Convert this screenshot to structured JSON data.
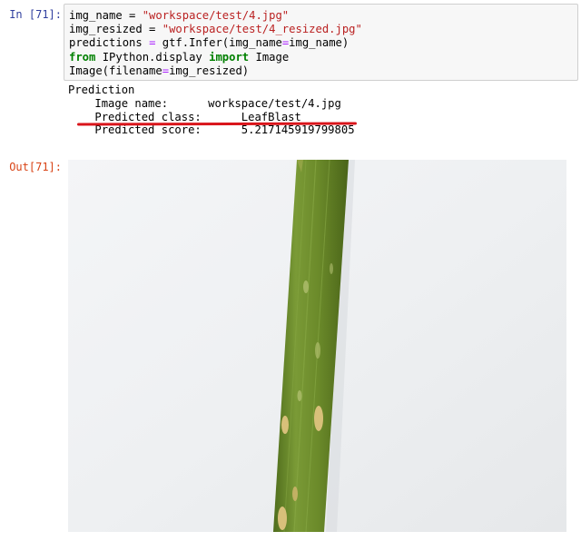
{
  "cell": {
    "in_prompt": "In [71]:",
    "out_prompt": "Out[71]:",
    "code_lines": {
      "line1": {
        "var": "img_name",
        "op": " = ",
        "value": "\"workspace/test/4.jpg\""
      },
      "line2": {
        "var": "img_resized",
        "op": " = ",
        "value": "\"workspace/test/4_resized.jpg\""
      },
      "line3": {
        "pre": "predictions ",
        "op": "=",
        "mid": " gtf.Infer(img_name",
        "op2": "=",
        "post": "img_name)"
      },
      "line4": {
        "kw_from": "from",
        "module": " IPython.display ",
        "kw_import": "import",
        "name": " Image"
      },
      "line5": {
        "pre": "Image(filename",
        "op": "=",
        "post": "img_resized)"
      }
    }
  },
  "prediction": {
    "heading": "Prediction",
    "image_name_label": "Image name:",
    "image_name_value": "workspace/test/4.jpg",
    "class_label": "Predicted class:",
    "class_value": "LeafBlast",
    "score_label": "Predicted score:",
    "score_value": "5.217145919799805"
  },
  "colors": {
    "input_prompt": "#303f9f",
    "output_prompt": "#d84315",
    "annotation_underline": "#d9151b",
    "leaf_green": "#6f8f2e",
    "lesion": "#d8c07a"
  },
  "output_image": {
    "subject": "rice leaf with blast lesions"
  }
}
